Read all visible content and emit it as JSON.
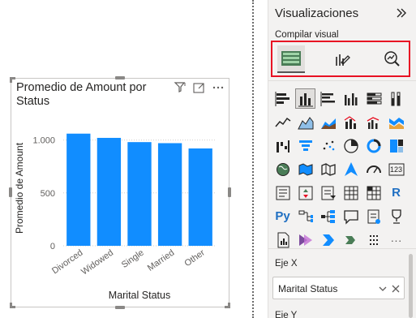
{
  "visual": {
    "title_line1": "Promedio de Amount por",
    "title_line2": "Status",
    "header_icons": [
      "filter-icon",
      "focus-mode-icon",
      "more-options-icon"
    ]
  },
  "chart_data": {
    "type": "bar",
    "title": "Promedio de Amount por Status",
    "xlabel": "Marital Status",
    "ylabel": "Promedio de Amount",
    "categories": [
      "Divorced",
      "Widowed",
      "Single",
      "Married",
      "Other"
    ],
    "values": [
      1060,
      1020,
      980,
      970,
      920
    ],
    "ylim": [
      0,
      1150
    ],
    "yticks": [
      0,
      500,
      1000
    ],
    "ytick_labels": [
      "0",
      "500",
      "1.000"
    ],
    "grid": true,
    "bar_color": "#118dff"
  },
  "pane": {
    "title": "Visualizaciones",
    "collapse_icon": "double-chevron-right-icon",
    "subtitle": "Compilar visual",
    "tabs": [
      "build-visual-icon",
      "format-visual-icon",
      "analytics-icon"
    ],
    "axis_well_label": "Eje X",
    "axis_well_value": "Marital Status",
    "next_label": "Eje Y"
  },
  "viz_icons": [
    [
      "stacked-bar-chart-icon",
      "stacked-column-chart-icon",
      "clustered-bar-chart-icon",
      "clustered-column-chart-icon",
      "100-stacked-bar-chart-icon",
      "100-stacked-column-chart-icon"
    ],
    [
      "line-chart-icon",
      "area-chart-icon",
      "stacked-area-chart-icon",
      "line-stacked-column-chart-icon",
      "line-clustered-column-chart-icon",
      "ribbon-chart-icon"
    ],
    [
      "waterfall-chart-icon",
      "funnel-chart-icon",
      "scatter-chart-icon",
      "pie-chart-icon",
      "donut-chart-icon",
      "treemap-icon"
    ],
    [
      "map-icon",
      "filled-map-icon",
      "shape-map-icon",
      "azure-map-icon",
      "gauge-icon",
      "card-icon"
    ],
    [
      "multi-row-card-icon",
      "kpi-icon",
      "slicer-icon",
      "table-icon",
      "matrix-icon",
      "r-visual-icon"
    ],
    [
      "python-visual-icon",
      "key-influencers-icon",
      "decomposition-tree-icon",
      "qa-icon",
      "smart-narrative-icon",
      "goals-icon"
    ],
    [
      "paginated-report-icon",
      "power-apps-icon",
      "power-automate-icon",
      "power-automate-flow-icon",
      "get-more-visuals-icon",
      "more-visuals-icon"
    ]
  ],
  "viz_text": {
    "card": "123",
    "r": "R",
    "py": "Py",
    "more": "···"
  }
}
